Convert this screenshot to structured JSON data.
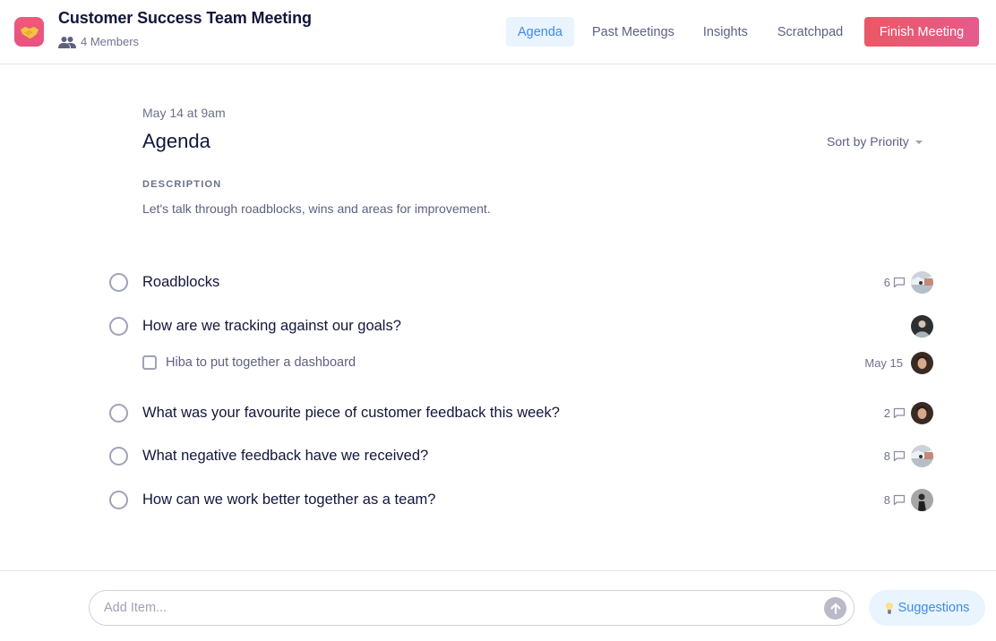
{
  "header": {
    "app_icon": "handshake-icon",
    "title": "Customer Success Team Meeting",
    "members_icon": "people-icon",
    "members_label": "4 Members"
  },
  "nav": {
    "tabs": [
      {
        "label": "Agenda",
        "active": true
      },
      {
        "label": "Past Meetings",
        "active": false
      },
      {
        "label": "Insights",
        "active": false
      },
      {
        "label": "Scratchpad",
        "active": false
      }
    ],
    "finish_label": "Finish Meeting"
  },
  "main": {
    "date": "May 14 at 9am",
    "title": "Agenda",
    "sort_label": "Sort by Priority",
    "description_label": "DESCRIPTION",
    "description": "Let's talk through roadblocks, wins and areas for improvement.",
    "items": [
      {
        "label": "Roadblocks",
        "comments": "6",
        "avatar": "avatar-landscape"
      },
      {
        "label": "How are we tracking against our goals?",
        "comments": null,
        "avatar": "avatar-man",
        "subitems": [
          {
            "label": "Hiba to put together a dashboard",
            "due": "May 15",
            "avatar": "avatar-woman"
          }
        ]
      },
      {
        "label": "What was your favourite piece of customer feedback this week?",
        "comments": "2",
        "avatar": "avatar-woman"
      },
      {
        "label": "What negative feedback have we received?",
        "comments": "8",
        "avatar": "avatar-landscape"
      },
      {
        "label": "How can we work better together as a team?",
        "comments": "8",
        "avatar": "avatar-bw"
      }
    ]
  },
  "footer": {
    "add_placeholder": "Add Item...",
    "add_value": "",
    "send_icon": "arrow-up-icon",
    "suggestions_icon": "lightbulb-icon",
    "suggestions_label": "Suggestions"
  },
  "colors": {
    "accent": "#3b8ce8",
    "finish_start": "#ea5866",
    "finish_end": "#e55b8c",
    "text_primary": "#12163a",
    "text_muted": "#6f7390"
  }
}
